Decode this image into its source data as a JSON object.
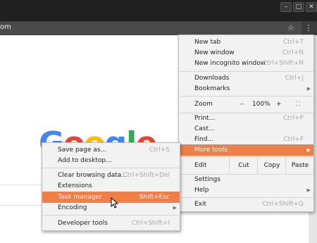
{
  "omnibox": {
    "url_fragment": "om",
    "star_icon": "star-icon"
  },
  "window_buttons": {
    "minimize": "–",
    "maximize": "□",
    "close": "✕"
  },
  "menu_icon": "⋮",
  "logo": {
    "letters": [
      "G",
      "o",
      "o",
      "g",
      "l",
      "e"
    ],
    "colors": [
      "#4285f4",
      "#ea4335",
      "#fbbc05",
      "#4285f4",
      "#34a853",
      "#ea4335"
    ]
  },
  "main_menu": {
    "new_tab": {
      "label": "New tab",
      "shortcut": "Ctrl+T"
    },
    "new_window": {
      "label": "New window",
      "shortcut": "Ctrl+N"
    },
    "new_incognito": {
      "label": "New incognito window",
      "shortcut": "Ctrl+Shift+N"
    },
    "downloads": {
      "label": "Downloads",
      "shortcut": "Ctrl+J"
    },
    "bookmarks": {
      "label": "Bookmarks"
    },
    "zoom": {
      "label": "Zoom",
      "minus": "–",
      "value": "100%",
      "plus": "+",
      "fullscreen": "⛶"
    },
    "print": {
      "label": "Print...",
      "shortcut": "Ctrl+P"
    },
    "cast": {
      "label": "Cast..."
    },
    "find": {
      "label": "Find...",
      "shortcut": "Ctrl+F"
    },
    "more_tools": {
      "label": "More tools"
    },
    "edit": {
      "label": "Edit",
      "cut": "Cut",
      "copy": "Copy",
      "paste": "Paste"
    },
    "settings": {
      "label": "Settings"
    },
    "help": {
      "label": "Help"
    },
    "exit": {
      "label": "Exit",
      "shortcut": "Ctrl+Shift+Q"
    }
  },
  "more_tools_menu": {
    "save_page": {
      "label": "Save page as...",
      "shortcut": "Ctrl+S"
    },
    "add_desktop": {
      "label": "Add to desktop..."
    },
    "clear_browsing": {
      "label": "Clear browsing data...",
      "shortcut": "Ctrl+Shift+Del"
    },
    "extensions": {
      "label": "Extensions"
    },
    "task_manager": {
      "label": "Task manager",
      "shortcut": "Shift+Esc"
    },
    "encoding": {
      "label": "Encoding"
    },
    "developer_tools": {
      "label": "Developer tools",
      "shortcut": "Ctrl+Shift+I"
    }
  },
  "accent_color": "#ee7f48"
}
